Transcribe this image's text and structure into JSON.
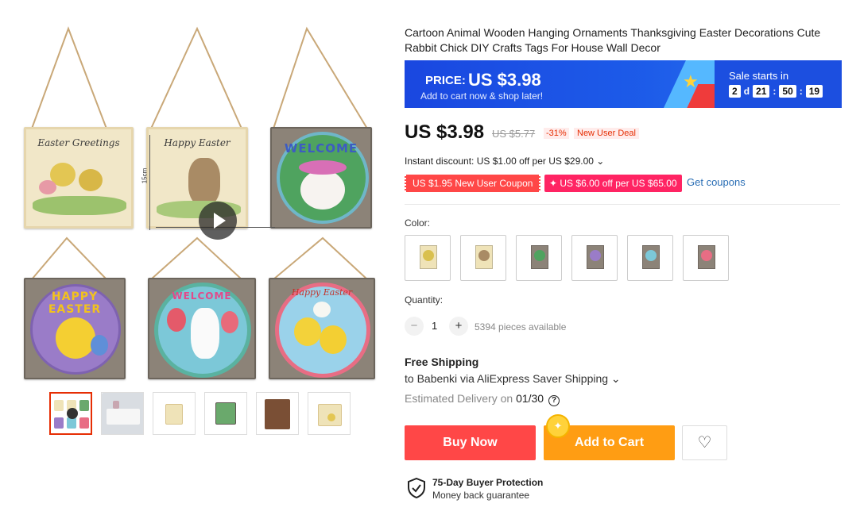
{
  "product": {
    "title": "Cartoon Animal Wooden Hanging Ornaments Thanksgiving Easter Decorations Cute Rabbit Chick DIY Crafts Tags For House Wall Decor"
  },
  "gallery": {
    "measure_label": "15cm",
    "boards": [
      {
        "caption": "Easter Greetings"
      },
      {
        "caption": "Happy Easter"
      },
      {
        "caption": "WELCOME"
      },
      {
        "caption": "HAPPY EASTER"
      },
      {
        "caption": "WELCOME"
      },
      {
        "caption": "Happy Easter"
      }
    ],
    "thumbnail_count": 6,
    "active_thumbnail": 1
  },
  "banner": {
    "price_label": "PRICE:",
    "price_value": "US $3.98",
    "sub_text": "Add to cart now & shop later!",
    "sale_label": "Sale starts in",
    "countdown": {
      "days": "2",
      "days_unit": "d",
      "hours": "21",
      "minutes": "50",
      "seconds": "19"
    }
  },
  "pricing": {
    "price": "US $3.98",
    "original_price": "US $5.77",
    "discount": "-31%",
    "deal_badge": "New User Deal",
    "instant_discount": "Instant discount: US $1.00 off per US $29.00 ⌄",
    "coupon_new_user": "US $1.95 New User Coupon",
    "coupon_store": "✦ US $6.00 off per US $65.00",
    "get_coupons": "Get coupons"
  },
  "options": {
    "color_label": "Color:",
    "swatch_count": 6
  },
  "quantity": {
    "label": "Quantity:",
    "minus": "−",
    "value": "1",
    "plus": "+",
    "available": "5394 pieces available"
  },
  "shipping": {
    "title": "Free Shipping",
    "detail": "to Babenki via AliExpress Saver Shipping ⌄",
    "estimated_prefix": "Estimated Delivery on ",
    "estimated_date": "01/30",
    "help_icon": "?"
  },
  "actions": {
    "buy_now": "Buy Now",
    "add_to_cart": "Add to Cart",
    "coin_glyph": "✦",
    "wishlist_glyph": "♡"
  },
  "protection": {
    "title": "75-Day Buyer Protection",
    "subtitle": "Money back guarantee"
  },
  "colors": {
    "accent_red": "#ff4747",
    "accent_orange": "#ff9d13",
    "banner_blue": "#1a47e0",
    "link_blue": "#2a6eb5"
  }
}
